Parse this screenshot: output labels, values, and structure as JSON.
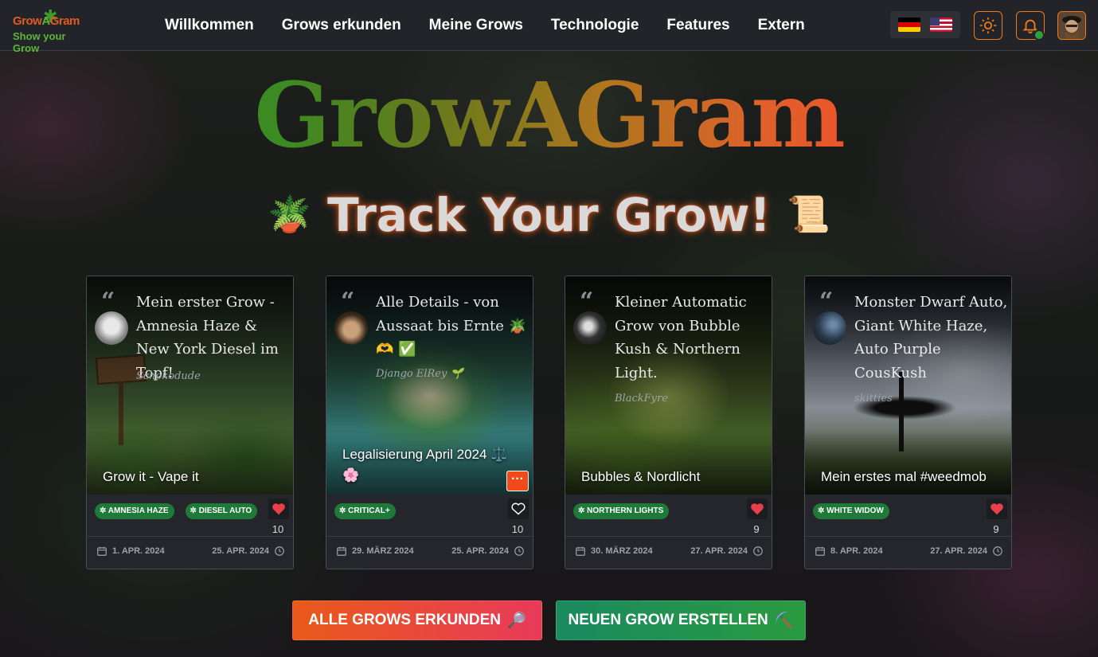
{
  "brand": {
    "logo_word_a": "Grow",
    "logo_word_b": "A",
    "logo_word_c": "Gram",
    "logo_sub": "Show your Grow"
  },
  "nav": {
    "items": [
      "Willkommen",
      "Grows erkunden",
      "Meine Grows",
      "Technologie",
      "Features",
      "Extern"
    ]
  },
  "header_icons": {
    "theme": "sun-icon",
    "notifications": "bell-icon",
    "accent": "#f07a1a"
  },
  "hero": {
    "title": "GrowAGram",
    "subtitle": "Track Your Grow!",
    "emoji_left": "🪴",
    "emoji_right": "📜"
  },
  "cards": [
    {
      "title": "Mein erster Grow - Amnesia Haze & New York Diesel im Topf!",
      "author": "Schokodude",
      "caption": "Grow it - Vape it",
      "tags": [
        "AMNESIA HAZE",
        "DIESEL AUTO"
      ],
      "liked": true,
      "likes": "10",
      "date_start": "1. APR. 2024",
      "date_end": "25. APR. 2024"
    },
    {
      "title": "Alle Details - von Aussaat bis Ernte 🪴 🫶 ✅",
      "author": "Django ElRey 🌱",
      "caption": "Legalisierung April 2024 ⚖️ 🌸",
      "tags": [
        "CRITICAL+"
      ],
      "liked": false,
      "likes": "10",
      "date_start": "29. MÄRZ 2024",
      "date_end": "25. APR. 2024"
    },
    {
      "title": "Kleiner Automatic Grow von Bubble Kush & Northern Light.",
      "author": "BlackFyre",
      "caption": "Bubbles & Nordlicht",
      "tags": [
        "NORTHERN LIGHTS"
      ],
      "liked": true,
      "likes": "9",
      "date_start": "30. MÄRZ 2024",
      "date_end": "27. APR. 2024"
    },
    {
      "title": "Monster Dwarf Auto, Giant White Haze, Auto Purple CousKush",
      "author": "skitties",
      "caption": "Mein erstes mal #weedmob",
      "tags": [
        "WHITE WIDOW"
      ],
      "liked": true,
      "likes": "9",
      "date_start": "8. APR. 2024",
      "date_end": "27. APR. 2024"
    }
  ],
  "buttons": {
    "explore_label": "ALLE GROWS ERKUNDEN",
    "explore_emoji": "🔎",
    "create_label": "NEUEN GROW ERSTELLEN",
    "create_emoji": "⛏️"
  },
  "more_button": "···"
}
